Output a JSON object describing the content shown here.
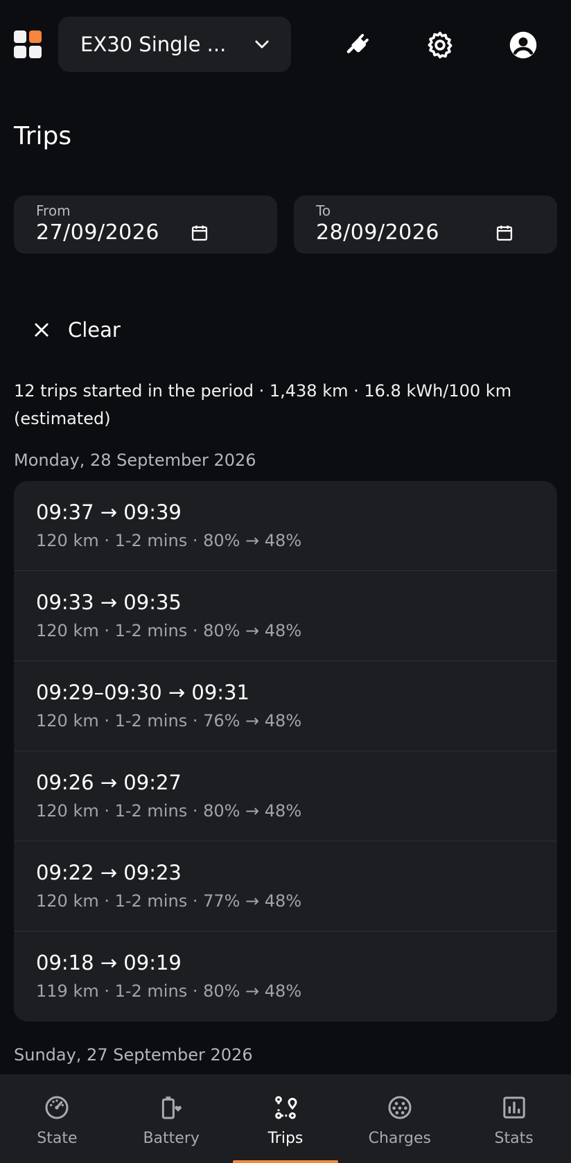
{
  "header": {
    "vehicle_name": "EX30 Single ...",
    "icons": [
      "apps-grid-icon",
      "chevron-down-icon",
      "plug-icon",
      "gear-icon",
      "account-icon"
    ],
    "accent_color": "#f5863b"
  },
  "page_title": "Trips",
  "filters": {
    "from_label": "From",
    "from_value": "27/09/2026",
    "to_label": "To",
    "to_value": "28/09/2026",
    "clear_label": "Clear"
  },
  "summary": "12 trips started in the period · 1,438 km · 16.8 kWh/100 km (estimated)",
  "days": [
    {
      "header": "Monday, 28 September 2026",
      "trips": [
        {
          "time": "09:37 → 09:39",
          "details": "120 km · 1-2 mins · 80% → 48%"
        },
        {
          "time": "09:33 → 09:35",
          "details": "120 km · 1-2 mins · 80% → 48%"
        },
        {
          "time": "09:29–09:30 → 09:31",
          "details": "120 km · 1-2 mins · 76% → 48%"
        },
        {
          "time": "09:26 → 09:27",
          "details": "120 km · 1-2 mins · 80% → 48%"
        },
        {
          "time": "09:22 → 09:23",
          "details": "120 km · 1-2 mins · 77% → 48%"
        },
        {
          "time": "09:18 → 09:19",
          "details": "119 km · 1-2 mins · 80% → 48%"
        }
      ]
    },
    {
      "header": "Sunday, 27 September 2026",
      "trips": []
    }
  ],
  "nav": {
    "items": [
      {
        "label": "State",
        "icon": "gauge-icon"
      },
      {
        "label": "Battery",
        "icon": "battery-heart-icon"
      },
      {
        "label": "Trips",
        "icon": "route-icon"
      },
      {
        "label": "Charges",
        "icon": "charge-connector-icon"
      },
      {
        "label": "Stats",
        "icon": "bar-chart-icon"
      }
    ],
    "active": "Trips"
  }
}
